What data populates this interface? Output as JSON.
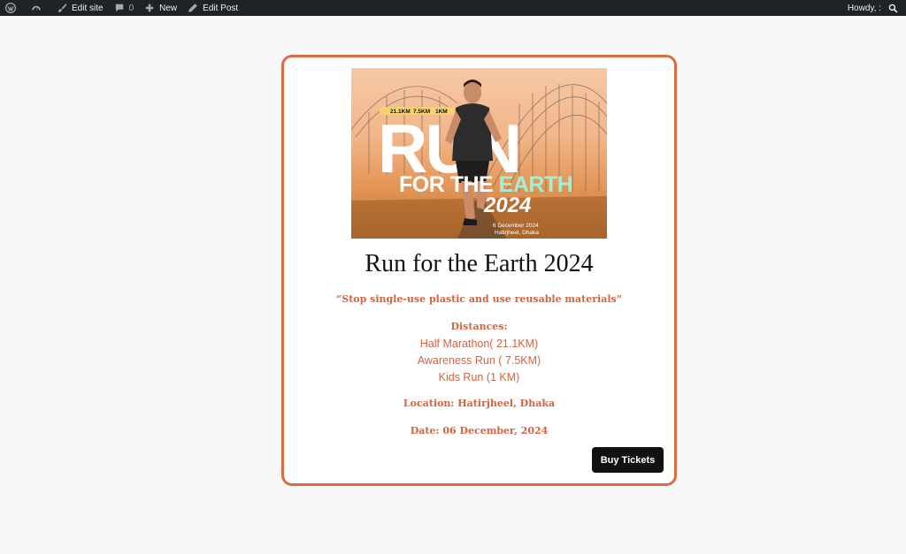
{
  "admin_bar": {
    "edit_site": "Edit site",
    "comments_count": "0",
    "new_label": "New",
    "edit_post": "Edit Post",
    "howdy": "Howdy, :",
    "icons": [
      "wordpress-logo-icon",
      "dashboard-icon",
      "brush-icon",
      "comment-icon",
      "plus-icon",
      "pencil-icon",
      "search-icon"
    ]
  },
  "banner": {
    "distances_tag": [
      "21.1KM",
      "7.5KM",
      "1KM"
    ],
    "headline_big": "RUN",
    "headline_line2_a": "FOR THE ",
    "headline_line2_b": "EARTH",
    "year": "2024",
    "date_line": "6 December 2024",
    "place_line": "Hatirjheel, Dhaka"
  },
  "event": {
    "title": "Run for the Earth 2024",
    "quote": "“Stop single-use plastic and use reusable materials”",
    "distances_heading": "Distances:",
    "distances": [
      "Half Marathon( 21.1KM)",
      "Awareness Run ( 7.5KM)",
      "Kids Run (1 KM)"
    ],
    "location": "Location: Hatirjheel, Dhaka",
    "date": "Date: 06 December, 2024",
    "buy_label": "Buy Tickets"
  },
  "colors": {
    "accent": "#dd6b42",
    "text_accent": "#d4633f",
    "admin_bar_bg": "#1d2327",
    "button_bg": "#111111",
    "mint": "#9ff0d6"
  }
}
